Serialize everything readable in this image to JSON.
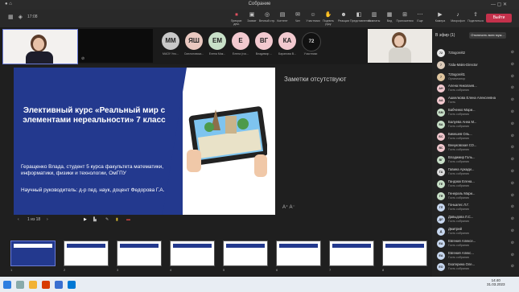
{
  "window": {
    "title": "Собрание",
    "time": "17:08"
  },
  "toolbar": {
    "left_icons": [
      "grid-icon",
      "shield-icon",
      "more-icon"
    ],
    "buttons": [
      {
        "label": "Прекрат. дем.",
        "icon": "stop-share-icon"
      },
      {
        "label": "Захват",
        "icon": "capture-icon"
      },
      {
        "label": "Вечный стр.",
        "icon": "broadcast-icon"
      },
      {
        "label": "Контент",
        "icon": "content-icon"
      },
      {
        "label": "Чат",
        "icon": "chat-icon"
      },
      {
        "label": "Участники",
        "icon": "people-icon"
      },
      {
        "label": "Поднять руку",
        "icon": "hand-icon"
      },
      {
        "label": "Реакции",
        "icon": "emoji-icon"
      },
      {
        "label": "Представления",
        "icon": "view-icon"
      },
      {
        "label": "Комнаты",
        "icon": "rooms-icon"
      },
      {
        "label": "Вид",
        "icon": "layout-icon"
      },
      {
        "label": "Приложения",
        "icon": "apps-icon"
      },
      {
        "label": "Еще",
        "icon": "more-icon"
      },
      {
        "label": "Камера",
        "icon": "camera-icon"
      },
      {
        "label": "Микрофон",
        "icon": "mic-icon"
      },
      {
        "label": "Поделиться",
        "icon": "share-icon"
      }
    ],
    "leave": "Выйти"
  },
  "strip": {
    "avatars": [
      {
        "initials": "ММ",
        "name": "МАОУ Уно...",
        "color": "#c8c8c8"
      },
      {
        "initials": "ЯШ",
        "name": "Сиплоновска...",
        "color": "#e9c8c0"
      },
      {
        "initials": "ЕМ",
        "name": "Елена Мак...",
        "color": "#c8e0c8"
      },
      {
        "initials": "Е",
        "name": "Елена (гос...",
        "color": "#f2c9cf"
      },
      {
        "initials": "ВГ",
        "name": "Владимир ...",
        "color": "#f2c9cf"
      },
      {
        "initials": "КА",
        "name": "Баранова В...",
        "color": "#f2c9cf"
      },
      {
        "initials": "72",
        "name": "Участники",
        "color": "#111111"
      }
    ]
  },
  "slide": {
    "title": "Элективный курс «Реальный мир с элементами нереальности» 7 класс",
    "author": "Геращенко Влада, студент 5 курса факультета математики, информатики, физики и технологии, ОмГПУ",
    "supervisor": "Научный руководитель: д-р пед. наук, доцент Федорова Г.А.",
    "counter": "1 из 18"
  },
  "notes": "Заметки отсутствуют",
  "thumbnails": [
    "1",
    "2",
    "3",
    "4",
    "5",
    "6",
    "7",
    "8",
    "9"
  ],
  "participants": {
    "header": "В эфир (1)",
    "mute_all": "Отключить всех муж...",
    "list": [
      {
        "initials": "72",
        "name": "72togorelt2",
        "role": "",
        "color": "#e8e8e8"
      },
      {
        "initials": "7",
        "name": "72da-Maks-Director",
        "role": "",
        "color": "#dcb"
      },
      {
        "initials": "7",
        "name": "72togorelt1",
        "role": "Организатор",
        "color": "#e0c6a0"
      },
      {
        "initials": "АН",
        "name": "Алена Николаев...",
        "role": "Гость собрания",
        "color": "#f2c9cf"
      },
      {
        "initials": "АА",
        "name": "Ашкелкова Елена Алексеевна",
        "role": "Гость",
        "color": "#f2c9cf"
      },
      {
        "initials": "БМ",
        "name": "Бабченко Мари...",
        "role": "Гость собрания",
        "color": "#c8e0c8"
      },
      {
        "initials": "БА",
        "name": "Балуева Анна М...",
        "role": "Гость собрания",
        "color": "#c8e0c8"
      },
      {
        "initials": "БС",
        "name": "Бикешев Оль...",
        "role": "Гость собрания",
        "color": "#f2c9cf"
      },
      {
        "initials": "ВС",
        "name": "Венуковская СО...",
        "role": "Гость собрания",
        "color": "#f2c9cf"
      },
      {
        "initials": "ВГ",
        "name": "Владимир Голь...",
        "role": "Гость собрания",
        "color": "#c8e0c8"
      },
      {
        "initials": "ГА",
        "name": "Гавина Аркади...",
        "role": "Гость собрания",
        "color": "#ddd"
      },
      {
        "initials": "ГЕ",
        "name": "Гандзюк Елена...",
        "role": "Гость собрания",
        "color": "#c8e0c8"
      },
      {
        "initials": "ГЯ",
        "name": "Генераль Мари...",
        "role": "Гость собрания",
        "color": "#c8e0c8"
      },
      {
        "initials": "ГЛ",
        "name": "Гоньалес Л.Г.",
        "role": "Гость собрания",
        "color": "#c8d8f0"
      },
      {
        "initials": "ДЛ",
        "name": "Давыдова Л.С...",
        "role": "Гость собрания",
        "color": "#c8d8f0"
      },
      {
        "initials": "Д",
        "name": "Дмитрий",
        "role": "Гость собрания",
        "color": "#c8d8f0"
      },
      {
        "initials": "ЕА",
        "name": "Евгения Алексе...",
        "role": "Гость собрания",
        "color": "#c8d8f0"
      },
      {
        "initials": "ЕА",
        "name": "Евгения Алекс...",
        "role": "Гость собрания",
        "color": "#c8d8f0"
      },
      {
        "initials": "ЕО",
        "name": "Екатерина Оле...",
        "role": "Гость собрания",
        "color": "#c8d8f0"
      }
    ]
  },
  "taskbar": {
    "time": "14:40",
    "date": "31.03.2023"
  }
}
